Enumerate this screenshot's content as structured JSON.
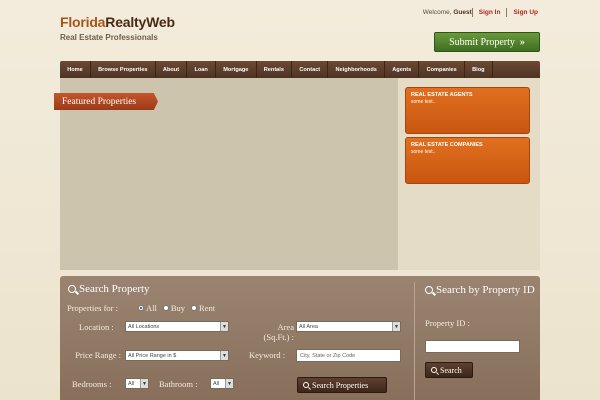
{
  "header": {
    "logo_part1": "Florida",
    "logo_part2": "RealtyWeb",
    "tagline": "Real Estate Professionals",
    "welcome": "Welcome,",
    "guest": "Guest",
    "sign_in": "Sign In",
    "sign_up": "Sign Up",
    "submit_property": "Submit Property",
    "submit_arrow": "»"
  },
  "nav": {
    "items": [
      "Home",
      "Browse Properties",
      "About",
      "Loan",
      "Mortgage",
      "Rentals",
      "Contact",
      "Neighborhoods",
      "Agents",
      "Companies",
      "Blog"
    ]
  },
  "featured": {
    "title": "Featured Properties"
  },
  "sidebar": {
    "boxes": [
      {
        "title": "REAL ESTATE AGENTS",
        "text": "some text.."
      },
      {
        "title": "REAL ESTATE COMPANIES",
        "text": "some text.."
      }
    ]
  },
  "search": {
    "title": "Search Property",
    "properties_for_label": "Properties for :",
    "radio_all": "All",
    "radio_buy": "Buy",
    "radio_rent": "Rent",
    "location_label": "Location :",
    "location_value": "All Locations",
    "area_label": "Area (Sq.Ft.) :",
    "area_value": "All Area",
    "price_label": "Price Range :",
    "price_value": "All Price Range in $",
    "keyword_label": "Keyword :",
    "keyword_placeholder": "City, State or Zip Code",
    "bedrooms_label": "Bedrooms :",
    "bedrooms_value": "All",
    "bathroom_label": "Bathroom :",
    "bathroom_value": "All",
    "search_button": "Search Properties"
  },
  "search_by_id": {
    "title": "Search by Property ID",
    "id_label": "Property ID :",
    "search_button": "Search"
  },
  "colors": {
    "accent_orange": "#d8651a",
    "nav_brown": "#5a3d2b",
    "submit_green": "#4f7f2c",
    "link_red": "#b0271c"
  }
}
